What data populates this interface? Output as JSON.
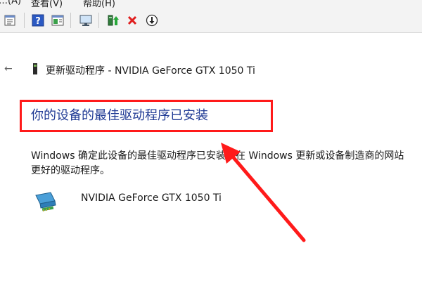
{
  "menubar": {
    "items": [
      {
        "label": "…(A)",
        "icon": "menu"
      },
      {
        "label": "查看(V)"
      },
      {
        "label": "帮助(H)"
      }
    ]
  },
  "toolbar": {
    "buttons": [
      {
        "icon": "properties-icon"
      },
      {
        "icon": "help-icon"
      },
      {
        "icon": "action-pane-icon"
      },
      {
        "icon": "monitor-scan-icon"
      },
      {
        "icon": "update-driver-icon"
      },
      {
        "icon": "uninstall-x-icon"
      },
      {
        "icon": "disable-device-icon"
      }
    ]
  },
  "dialog": {
    "header_title": "更新驱动程序 - NVIDIA GeForce GTX 1050 Ti",
    "headline": "你的设备的最佳驱动程序已安装",
    "description_line1": "Windows 确定此设备的最佳驱动程序已安装。在 Windows 更新或设备制造商的网站",
    "description_line2": "更好的驱动程序。",
    "device_name": "NVIDIA GeForce GTX 1050 Ti"
  },
  "colors": {
    "headline": "#1f3a94",
    "annotation_red": "#ff1a1a",
    "toolbar_bg": "#f3f3f3"
  }
}
